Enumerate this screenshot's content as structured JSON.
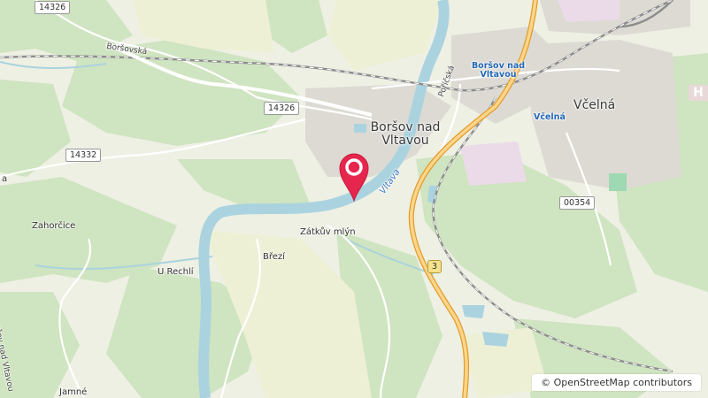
{
  "map": {
    "places": {
      "borsov_town": "Boršov nad Vltavou",
      "vcelna": "Včelná",
      "zahorcice": "Zahorčice",
      "u_rechli": "U Rechlí",
      "brezi": "Březí",
      "zatkuv_mlyn": "Zátkův mlýn",
      "jamne": "Jamné",
      "borsovska": "Boršovská",
      "poricska": "Poříčská",
      "borsov_side": "Boršov nad Vltavou"
    },
    "stations": {
      "borsov": "Boršov nad Vltavou",
      "vcelna": "Včelná"
    },
    "river": "Vltava",
    "roads": {
      "r14326_top": "14326",
      "r14326_mid": "14326",
      "r14332": "14332",
      "r00354": "00354",
      "route3": "3"
    },
    "edge_label": "a",
    "hlogo": "H"
  },
  "attribution": "© OpenStreetMap contributors"
}
